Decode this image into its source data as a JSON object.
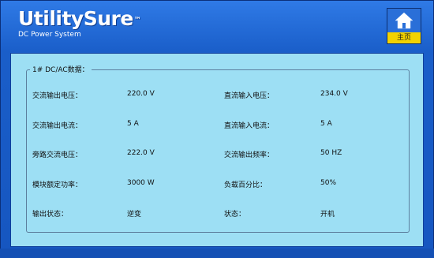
{
  "brand": {
    "name": "UtilitySure",
    "tm": "™",
    "subtitle": "DC Power System"
  },
  "home_button": {
    "label": "主页"
  },
  "panel": {
    "title": "1# DC/AC数据：",
    "rows": [
      {
        "left_label": "交流输出电压：",
        "left_value": "220.0 V",
        "right_label": "直流输入电压：",
        "right_value": "234.0 V"
      },
      {
        "left_label": "交流输出电流：",
        "left_value": "5 A",
        "right_label": "直流输入电流：",
        "right_value": "5 A"
      },
      {
        "left_label": "旁路交流电压：",
        "left_value": "222.0 V",
        "right_label": "交流输出频率：",
        "right_value": "50 HZ"
      },
      {
        "left_label": "模块额定功率：",
        "left_value": "3000 W",
        "right_label": "负载百分比：",
        "right_value": "50%"
      },
      {
        "left_label": "输出状态：",
        "left_value": "逆变",
        "right_label": "状态：",
        "right_value": "开机"
      }
    ]
  },
  "colors": {
    "background": "#1a5ec9",
    "panel": "#9ddff4",
    "home_label": "#f2d200"
  }
}
